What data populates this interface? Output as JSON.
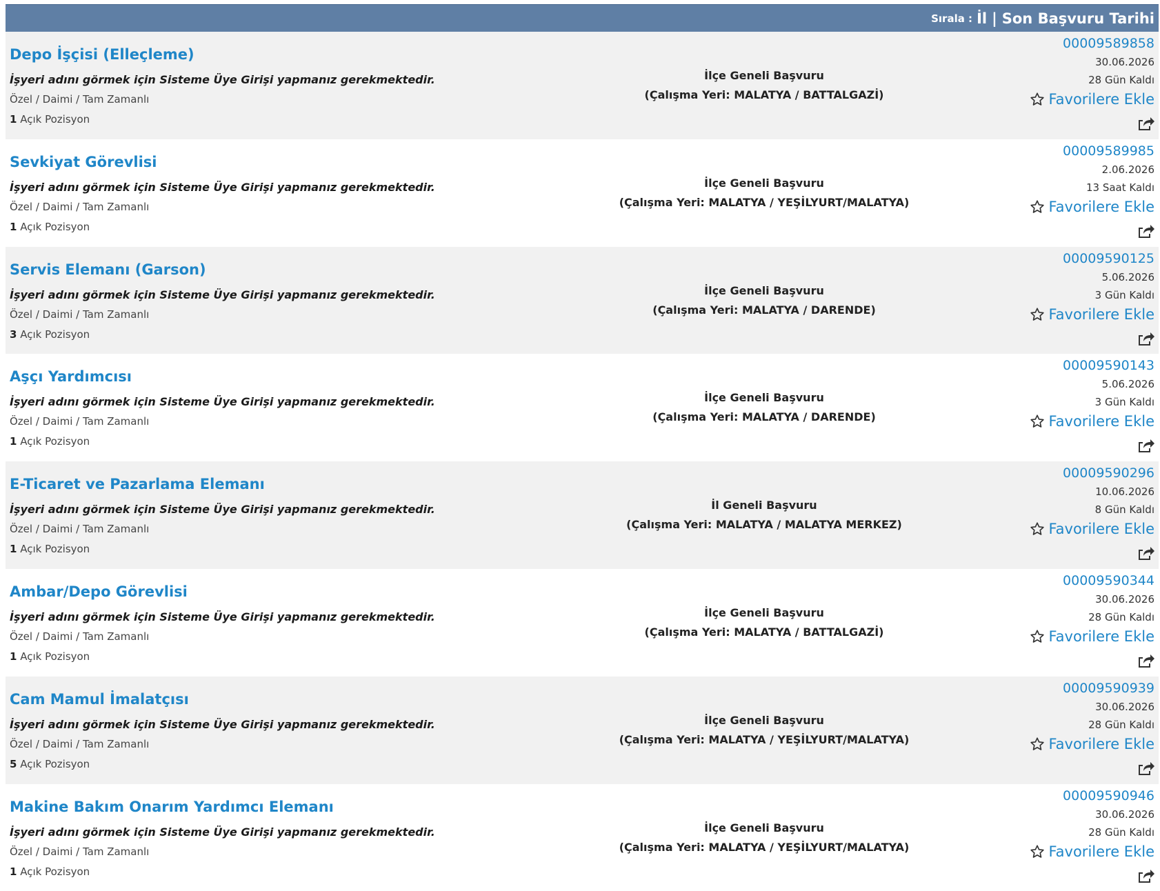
{
  "sort": {
    "label": "Sırala :",
    "option_il": "İl",
    "separator": "|",
    "option_date": "Son Başvuru Tarihi"
  },
  "colors": {
    "header_bg": "#5f7fa5",
    "link": "#1f86c8",
    "row_alt": "#f1f1f1"
  },
  "icons": {
    "favorite": "star-outline-icon",
    "share": "share-icon"
  },
  "jobs": [
    {
      "title": "Depo İşçisi (Elleçleme)",
      "note": "İşyeri adını görmek için Sisteme Üye Girişi yapmanız gerekmektedir.",
      "type": "Özel / Daimi / Tam Zamanlı",
      "count": "1",
      "count_label": "Açık Pozisyon",
      "scope": "İlçe Geneli Başvuru",
      "location": "(Çalışma Yeri: MALATYA / BATTALGAZİ)",
      "ilan_no": "00009589858",
      "deadline": "30.06.2026",
      "remaining": "28 Gün Kaldı",
      "fav_label": "Favorilere Ekle"
    },
    {
      "title": "Sevkiyat Görevlisi",
      "note": "İşyeri adını görmek için Sisteme Üye Girişi yapmanız gerekmektedir.",
      "type": "Özel / Daimi / Tam Zamanlı",
      "count": "1",
      "count_label": "Açık Pozisyon",
      "scope": "İlçe Geneli Başvuru",
      "location": "(Çalışma Yeri: MALATYA / YEŞİLYURT/MALATYA)",
      "ilan_no": "00009589985",
      "deadline": "2.06.2026",
      "remaining": "13 Saat Kaldı",
      "fav_label": "Favorilere Ekle"
    },
    {
      "title": "Servis Elemanı (Garson)",
      "note": "İşyeri adını görmek için Sisteme Üye Girişi yapmanız gerekmektedir.",
      "type": "Özel / Daimi / Tam Zamanlı",
      "count": "3",
      "count_label": "Açık Pozisyon",
      "scope": "İlçe Geneli Başvuru",
      "location": "(Çalışma Yeri: MALATYA / DARENDE)",
      "ilan_no": "00009590125",
      "deadline": "5.06.2026",
      "remaining": "3 Gün Kaldı",
      "fav_label": "Favorilere Ekle"
    },
    {
      "title": "Aşçı Yardımcısı",
      "note": "İşyeri adını görmek için Sisteme Üye Girişi yapmanız gerekmektedir.",
      "type": "Özel / Daimi / Tam Zamanlı",
      "count": "1",
      "count_label": "Açık Pozisyon",
      "scope": "İlçe Geneli Başvuru",
      "location": "(Çalışma Yeri: MALATYA / DARENDE)",
      "ilan_no": "00009590143",
      "deadline": "5.06.2026",
      "remaining": "3 Gün Kaldı",
      "fav_label": "Favorilere Ekle"
    },
    {
      "title": "E-Ticaret ve Pazarlama Elemanı",
      "note": "İşyeri adını görmek için Sisteme Üye Girişi yapmanız gerekmektedir.",
      "type": "Özel / Daimi / Tam Zamanlı",
      "count": "1",
      "count_label": "Açık Pozisyon",
      "scope": "İl Geneli Başvuru",
      "location": "(Çalışma Yeri: MALATYA / MALATYA MERKEZ)",
      "ilan_no": "00009590296",
      "deadline": "10.06.2026",
      "remaining": "8 Gün Kaldı",
      "fav_label": "Favorilere Ekle"
    },
    {
      "title": "Ambar/Depo Görevlisi",
      "note": "İşyeri adını görmek için Sisteme Üye Girişi yapmanız gerekmektedir.",
      "type": "Özel / Daimi / Tam Zamanlı",
      "count": "1",
      "count_label": "Açık Pozisyon",
      "scope": "İlçe Geneli Başvuru",
      "location": "(Çalışma Yeri: MALATYA / BATTALGAZİ)",
      "ilan_no": "00009590344",
      "deadline": "30.06.2026",
      "remaining": "28 Gün Kaldı",
      "fav_label": "Favorilere Ekle"
    },
    {
      "title": "Cam Mamul İmalatçısı",
      "note": "İşyeri adını görmek için Sisteme Üye Girişi yapmanız gerekmektedir.",
      "type": "Özel / Daimi / Tam Zamanlı",
      "count": "5",
      "count_label": "Açık Pozisyon",
      "scope": "İlçe Geneli Başvuru",
      "location": "(Çalışma Yeri: MALATYA / YEŞİLYURT/MALATYA)",
      "ilan_no": "00009590939",
      "deadline": "30.06.2026",
      "remaining": "28 Gün Kaldı",
      "fav_label": "Favorilere Ekle"
    },
    {
      "title": "Makine Bakım Onarım Yardımcı Elemanı",
      "note": "İşyeri adını görmek için Sisteme Üye Girişi yapmanız gerekmektedir.",
      "type": "Özel / Daimi / Tam Zamanlı",
      "count": "1",
      "count_label": "Açık Pozisyon",
      "scope": "İlçe Geneli Başvuru",
      "location": "(Çalışma Yeri: MALATYA / YEŞİLYURT/MALATYA)",
      "ilan_no": "00009590946",
      "deadline": "30.06.2026",
      "remaining": "28 Gün Kaldı",
      "fav_label": "Favorilere Ekle"
    }
  ]
}
